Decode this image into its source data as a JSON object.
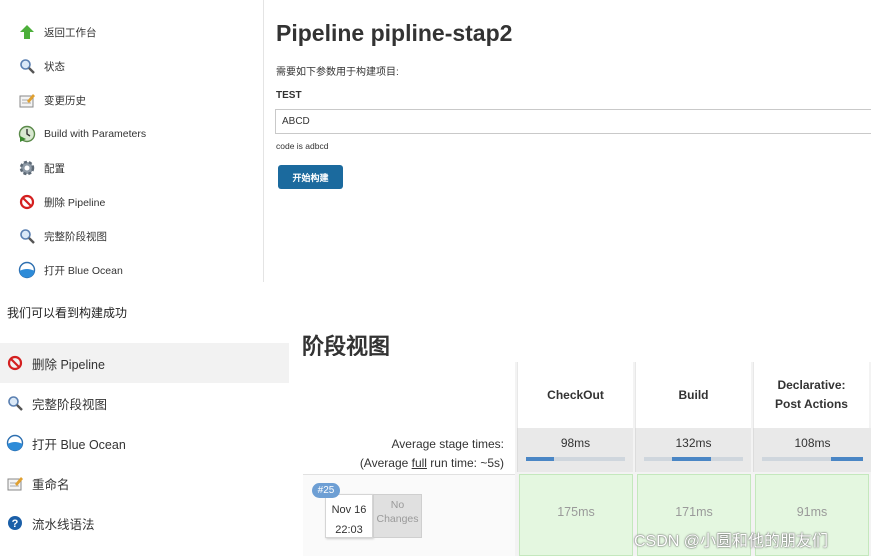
{
  "top_sidebar": {
    "items": [
      {
        "label": "返回工作台",
        "icon": "up-arrow-icon"
      },
      {
        "label": "状态",
        "icon": "magnifier-icon"
      },
      {
        "label": "变更历史",
        "icon": "notepad-icon"
      },
      {
        "label": "Build with Parameters",
        "icon": "clock-play-icon"
      },
      {
        "label": "配置",
        "icon": "gear-icon"
      },
      {
        "label": "删除 Pipeline",
        "icon": "no-entry-icon"
      },
      {
        "label": "完整阶段视图",
        "icon": "magnifier-icon"
      },
      {
        "label": "打开 Blue Ocean",
        "icon": "blue-ocean-icon"
      }
    ]
  },
  "build_form": {
    "title": "Pipeline pipline-stap2",
    "description": "需要如下参数用于构建项目:",
    "param_name": "TEST",
    "param_value": "ABCD",
    "param_description": "code is adbcd",
    "submit_label": "开始构建"
  },
  "caption": "我们可以看到构建成功",
  "bottom_sidebar": {
    "items": [
      {
        "label": "删除 Pipeline",
        "icon": "no-entry-icon",
        "active": true
      },
      {
        "label": "完整阶段视图",
        "icon": "magnifier-icon"
      },
      {
        "label": "打开 Blue Ocean",
        "icon": "blue-ocean-icon"
      },
      {
        "label": "重命名",
        "icon": "notepad-icon"
      },
      {
        "label": "流水线语法",
        "icon": "help-icon"
      }
    ]
  },
  "stage_view": {
    "title": "阶段视图",
    "average_label": "Average stage times:",
    "full_run_prefix": "(Average ",
    "full_run_link": "full",
    "full_run_suffix": " run time: ~5s)",
    "stages": [
      {
        "name": "CheckOut",
        "avg": "98ms",
        "progress_start": 0.0,
        "progress_end": 0.28
      },
      {
        "name": "Build",
        "avg": "132ms",
        "progress_start": 0.28,
        "progress_end": 0.68
      },
      {
        "name": "Declarative: Post Actions",
        "avg": "108ms",
        "progress_start": 0.68,
        "progress_end": 1.0
      }
    ],
    "run": {
      "badge": "#25",
      "date": "Nov 16",
      "time": "22:03",
      "changes_line1": "No",
      "changes_line2": "Changes",
      "durations": [
        "175ms",
        "171ms",
        "91ms"
      ]
    }
  },
  "watermark": "CSDN @小圆和他的朋友们",
  "colors": {
    "button": "#1b6a9e",
    "success_cell": "#e4f7e0",
    "progress": "#4a86c5",
    "badge": "#6e9fd4"
  }
}
